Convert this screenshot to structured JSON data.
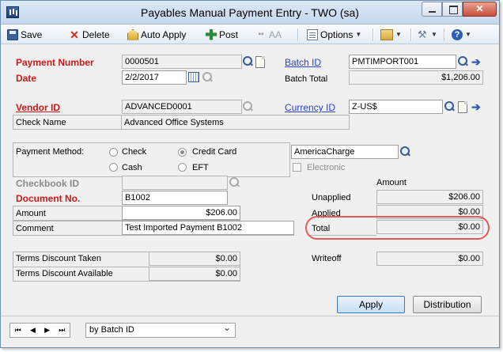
{
  "window": {
    "title": "Payables Manual Payment Entry  -  TWO (sa)"
  },
  "toolbar": {
    "save": "Save",
    "delete": "Delete",
    "auto_apply": "Auto Apply",
    "post": "Post",
    "aa": "AA",
    "options": "Options"
  },
  "form": {
    "payment_number_label": "Payment Number",
    "payment_number": "0000501",
    "date_label": "Date",
    "date": "2/2/2017",
    "batch_id_label": "Batch ID",
    "batch_id": "PMTIMPORT001",
    "batch_total_label": "Batch Total",
    "batch_total": "$1,206.00",
    "vendor_id_label": "Vendor ID",
    "vendor_id": "ADVANCED0001",
    "currency_id_label": "Currency ID",
    "currency_id": "Z-US$",
    "check_name_label": "Check Name",
    "check_name": "Advanced Office Systems",
    "payment_method_label": "Payment Method:",
    "payment_methods": {
      "check": "Check",
      "credit_card": "Credit Card",
      "cash": "Cash",
      "eft": "EFT"
    },
    "selected_method": "Credit Card",
    "card_name": "AmericaCharge",
    "electronic_label": "Electronic",
    "checkbook_id_label": "Checkbook ID",
    "document_no_label": "Document No.",
    "document_no": "B1002",
    "amount_label": "Amount",
    "amount": "$206.00",
    "comment_label": "Comment",
    "comment": "Test Imported Payment B1002",
    "terms_discount_taken_label": "Terms Discount Taken",
    "terms_discount_taken": "$0.00",
    "terms_discount_available_label": "Terms Discount Available",
    "terms_discount_available": "$0.00"
  },
  "summary": {
    "amount_header": "Amount",
    "unapplied_label": "Unapplied",
    "unapplied": "$206.00",
    "applied_label": "Applied",
    "applied": "$0.00",
    "total_label": "Total",
    "total": "$0.00",
    "writeoff_label": "Writeoff",
    "writeoff": "$0.00"
  },
  "buttons": {
    "apply": "Apply",
    "distribution": "Distribution"
  },
  "footer": {
    "sort_by": "by Batch ID"
  },
  "colors": {
    "required_label": "#d01818",
    "link": "#2842c8",
    "callout": "#e05a5a"
  }
}
